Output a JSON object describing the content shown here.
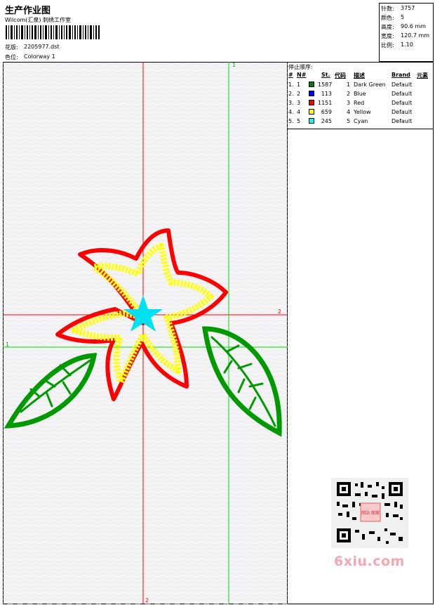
{
  "header": {
    "title": "生产作业图",
    "company": "Wilcom(汇泉) 刺绣工作室",
    "design_label": "花版:",
    "design_name": "2205977.dst",
    "color_label": "色位:",
    "colorway": "Colorway 1"
  },
  "stats": {
    "stitches_label": "针数:",
    "stitches": "3757",
    "colors_label": "颜色:",
    "colors": "5",
    "height_label": "高度:",
    "height": "90.6 mm",
    "width_label": "宽度:",
    "width": "120.7 mm",
    "scale_label": "比例:",
    "scale": "1.10"
  },
  "stop_sequence": {
    "title": "停止顺序:",
    "columns": [
      "#",
      "N#",
      "St.",
      "代码",
      "描述",
      "Brand",
      "元素"
    ],
    "rows": [
      {
        "idx": "1.",
        "n": "1",
        "color": "#008000",
        "st": "1587",
        "code": "1",
        "desc": "Dark Green",
        "brand": "Default"
      },
      {
        "idx": "2.",
        "n": "2",
        "color": "#0000ff",
        "st": "113",
        "code": "2",
        "desc": "Blue",
        "brand": "Default"
      },
      {
        "idx": "3.",
        "n": "3",
        "color": "#ff0000",
        "st": "1151",
        "code": "3",
        "desc": "Red",
        "brand": "Default"
      },
      {
        "idx": "4.",
        "n": "4",
        "color": "#ffff00",
        "st": "659",
        "code": "4",
        "desc": "Yellow",
        "brand": "Default"
      },
      {
        "idx": "5.",
        "n": "5",
        "color": "#00ffff",
        "st": "245",
        "code": "5",
        "desc": "Cyan",
        "brand": "Default"
      }
    ]
  },
  "guides": {
    "red_top": "",
    "red_right": "2",
    "red_bottom": "2",
    "green_top": "1",
    "green_left": "1"
  },
  "watermark": {
    "site": "6xiu.com",
    "stamp": "网站 图案"
  },
  "colors": {
    "red_guide": "#ff0000",
    "green_guide": "#00e000",
    "leaf": "#009900",
    "petal_outline": "#ff0000",
    "petal_fill": "#ffff00",
    "center": "#00e0f0",
    "canvas_bg": "#f4f4f6"
  }
}
